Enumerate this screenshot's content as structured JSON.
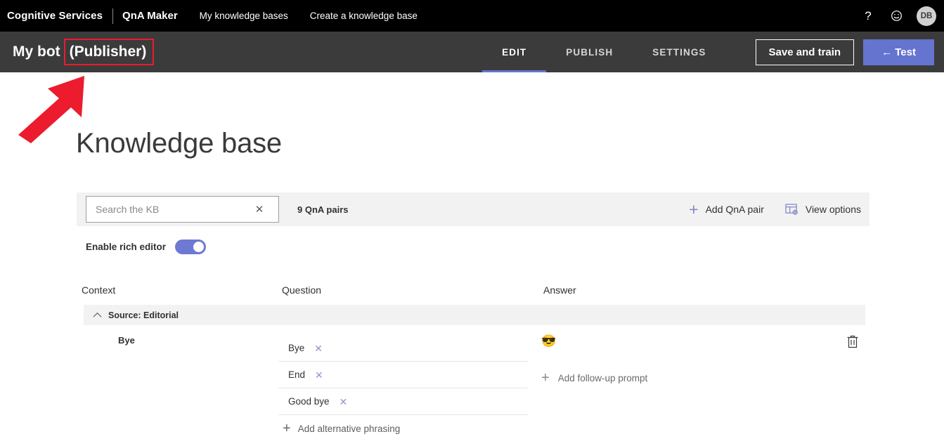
{
  "topnav": {
    "brand": "Cognitive Services",
    "product": "QnA Maker",
    "links": [
      {
        "label": "My knowledge bases"
      },
      {
        "label": "Create a knowledge base"
      }
    ],
    "help_icon": "?",
    "feedback_icon": "smiley-icon",
    "avatar_initials": "DB"
  },
  "subbar": {
    "bot_name": "My bot",
    "publisher_badge": "(Publisher)",
    "annotation_color": "#ec1b2e",
    "tabs": [
      {
        "label": "EDIT",
        "active": true
      },
      {
        "label": "PUBLISH",
        "active": false
      },
      {
        "label": "SETTINGS",
        "active": false
      }
    ],
    "save_label": "Save and train",
    "test_label": "← Test",
    "accent_color": "#6574cf"
  },
  "page": {
    "title": "Knowledge base"
  },
  "toolbar": {
    "search_placeholder": "Search the KB",
    "search_value": "",
    "clear_icon": "✕",
    "pairs_count": "9 QnA pairs",
    "add_pair_label": "Add QnA pair",
    "add_pair_icon": "+",
    "view_options_label": "View options",
    "command_color": "#8285cb"
  },
  "rich_editor": {
    "label": "Enable rich editor",
    "enabled": true,
    "on_color": "#6d79d2"
  },
  "grid": {
    "columns": [
      {
        "label": "Context"
      },
      {
        "label": "Question"
      },
      {
        "label": "Answer"
      }
    ],
    "source": {
      "label": "Source: Editorial",
      "expanded": true
    },
    "row": {
      "context": "Bye",
      "questions": [
        {
          "text": "Bye",
          "remove_icon": "✕"
        },
        {
          "text": "End",
          "remove_icon": "✕"
        },
        {
          "text": "Good bye",
          "remove_icon": "✕"
        }
      ],
      "add_phrasing_label": "Add alternative phrasing",
      "add_phrasing_icon": "+",
      "answer_emoji": "😎",
      "add_followup_label": "Add follow-up prompt",
      "add_followup_icon": "+",
      "delete_icon": "trash-icon"
    }
  }
}
